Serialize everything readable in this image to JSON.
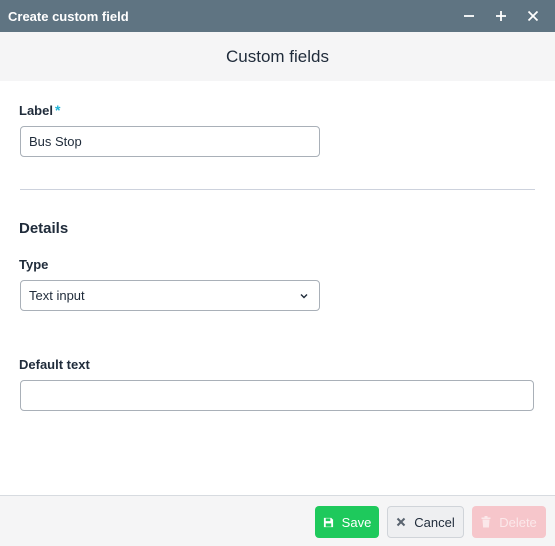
{
  "window": {
    "title": "Create custom field",
    "controls": [
      "minimize-icon",
      "maximize-icon",
      "close-icon"
    ]
  },
  "header": {
    "title": "Custom fields"
  },
  "form": {
    "label_field": {
      "label": "Label",
      "required_mark": "*",
      "value": "Bus Stop"
    },
    "details_heading": "Details",
    "type_field": {
      "label": "Type",
      "selected": "Text input"
    },
    "default_text_field": {
      "label": "Default text",
      "value": ""
    }
  },
  "footer": {
    "save_label": "Save",
    "cancel_label": "Cancel",
    "delete_label": "Delete"
  },
  "colors": {
    "titlebar": "#5f7482",
    "accent_required": "#1fb3d6",
    "save": "#1ec95c",
    "delete_disabled": "#f6c6cb"
  }
}
